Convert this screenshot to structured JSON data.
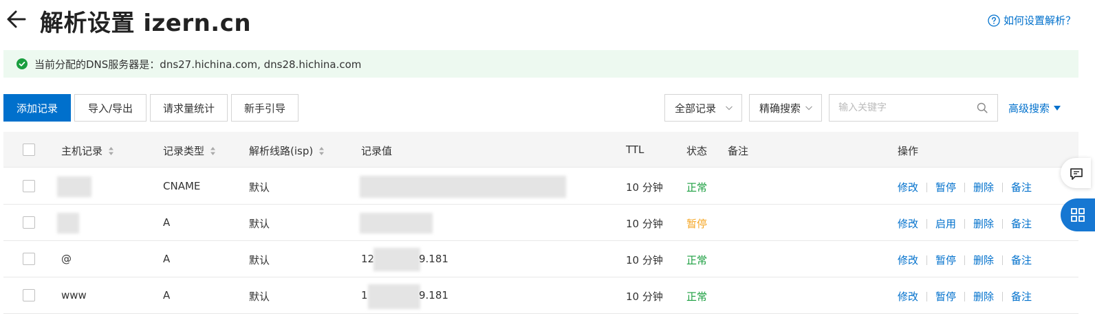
{
  "header": {
    "title": "解析设置 izern.cn",
    "help_link": "如何设置解析？"
  },
  "dns_banner": {
    "text": "当前分配的DNS服务器是：dns27.hichina.com, dns28.hichina.com",
    "status_color": "#1a9e3f"
  },
  "toolbar": {
    "add_record": "添加记录",
    "import_export": "导入/导出",
    "request_stats": "请求量统计",
    "beginner_guide": "新手引导",
    "filter_select": "全部记录",
    "search_mode_select": "精确搜索",
    "search_placeholder": "输入关键字",
    "advanced_search": "高级搜索"
  },
  "table": {
    "columns": {
      "host": "主机记录",
      "type": "记录类型",
      "line": "解析线路(isp)",
      "value": "记录值",
      "ttl": "TTL",
      "status": "状态",
      "remark": "备注",
      "actions": "操作"
    },
    "rows": [
      {
        "host": "",
        "type": "CNAME",
        "line": "默认",
        "value": "",
        "ttl": "10 分钟",
        "status": "正常",
        "actions": [
          "修改",
          "暂停",
          "删除",
          "备注"
        ]
      },
      {
        "host": "",
        "type": "A",
        "line": "默认",
        "value": "",
        "ttl": "10 分钟",
        "status": "暂停",
        "actions": [
          "修改",
          "启用",
          "删除",
          "备注"
        ]
      },
      {
        "host": "@",
        "type": "A",
        "line": "默认",
        "value_prefix": "12",
        "value_suffix": "9.181",
        "ttl": "10 分钟",
        "status": "正常",
        "actions": [
          "修改",
          "暂停",
          "删除",
          "备注"
        ]
      },
      {
        "host": "www",
        "type": "A",
        "line": "默认",
        "value_prefix": "1",
        "value_suffix": "9.181",
        "ttl": "10 分钟",
        "status": "正常",
        "actions": [
          "修改",
          "暂停",
          "删除",
          "备注"
        ]
      }
    ]
  },
  "colors": {
    "primary": "#0070cc",
    "status_normal": "#1a9e3f",
    "status_paused": "#f5a623",
    "banner_bg": "#edf9f0"
  },
  "icons": {
    "back": "arrow-left-icon",
    "help": "question-circle-icon",
    "success": "check-circle-icon",
    "search": "search-icon",
    "sort": "sort-icon",
    "chat": "chat-icon",
    "apps": "apps-icon"
  }
}
